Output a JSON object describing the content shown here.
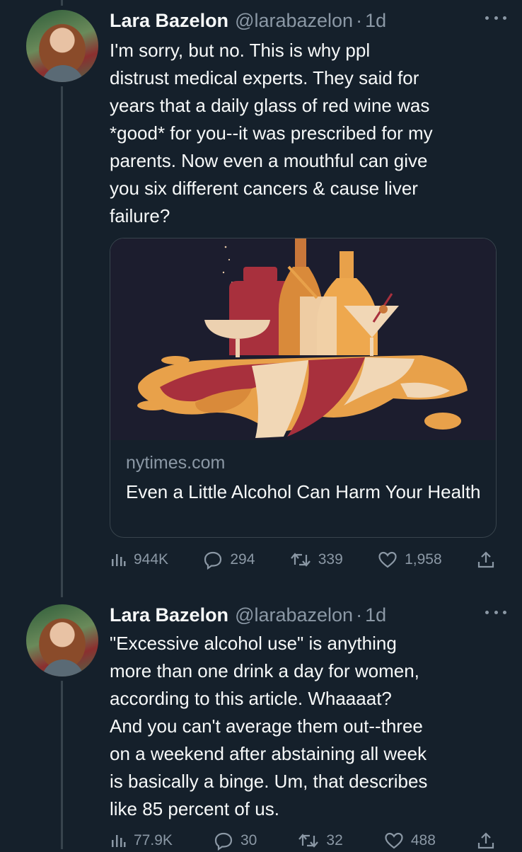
{
  "tweets": [
    {
      "author": {
        "name": "Lara Bazelon",
        "handle": "@larabazelon",
        "time": "1d"
      },
      "text_lines": [
        "I'm sorry, but no.  This is why ppl",
        "distrust medical experts.  They said for",
        "years that a daily glass of red wine was",
        "*good* for you--it was prescribed for my",
        "parents.  Now even a mouthful can give",
        "you six different cancers & cause liver",
        "failure?"
      ],
      "card": {
        "domain": "nytimes.com",
        "title": "Even a Little Alcohol Can Harm Your Health"
      },
      "stats": {
        "views": "944K",
        "replies": "294",
        "retweets": "339",
        "likes": "1,958"
      }
    },
    {
      "author": {
        "name": "Lara Bazelon",
        "handle": "@larabazelon",
        "time": "1d"
      },
      "text_lines": [
        "\"Excessive alcohol use\" is anything",
        "more than one drink a day for women,",
        "according to this article.  Whaaaat?",
        "And you can't average them out--three",
        "on a weekend after abstaining all week",
        "is basically a binge. Um, that describes",
        "like 85 percent of us."
      ],
      "stats": {
        "views": "77.9K",
        "replies": "30",
        "retweets": "32",
        "likes": "488"
      }
    }
  ],
  "separator": "·",
  "colors": {
    "background": "#15202b",
    "text": "#f7f9f9",
    "muted": "#8b98a5",
    "border": "#38444d"
  },
  "icons": [
    "more-icon",
    "views-icon",
    "reply-icon",
    "retweet-icon",
    "like-icon",
    "share-icon"
  ]
}
